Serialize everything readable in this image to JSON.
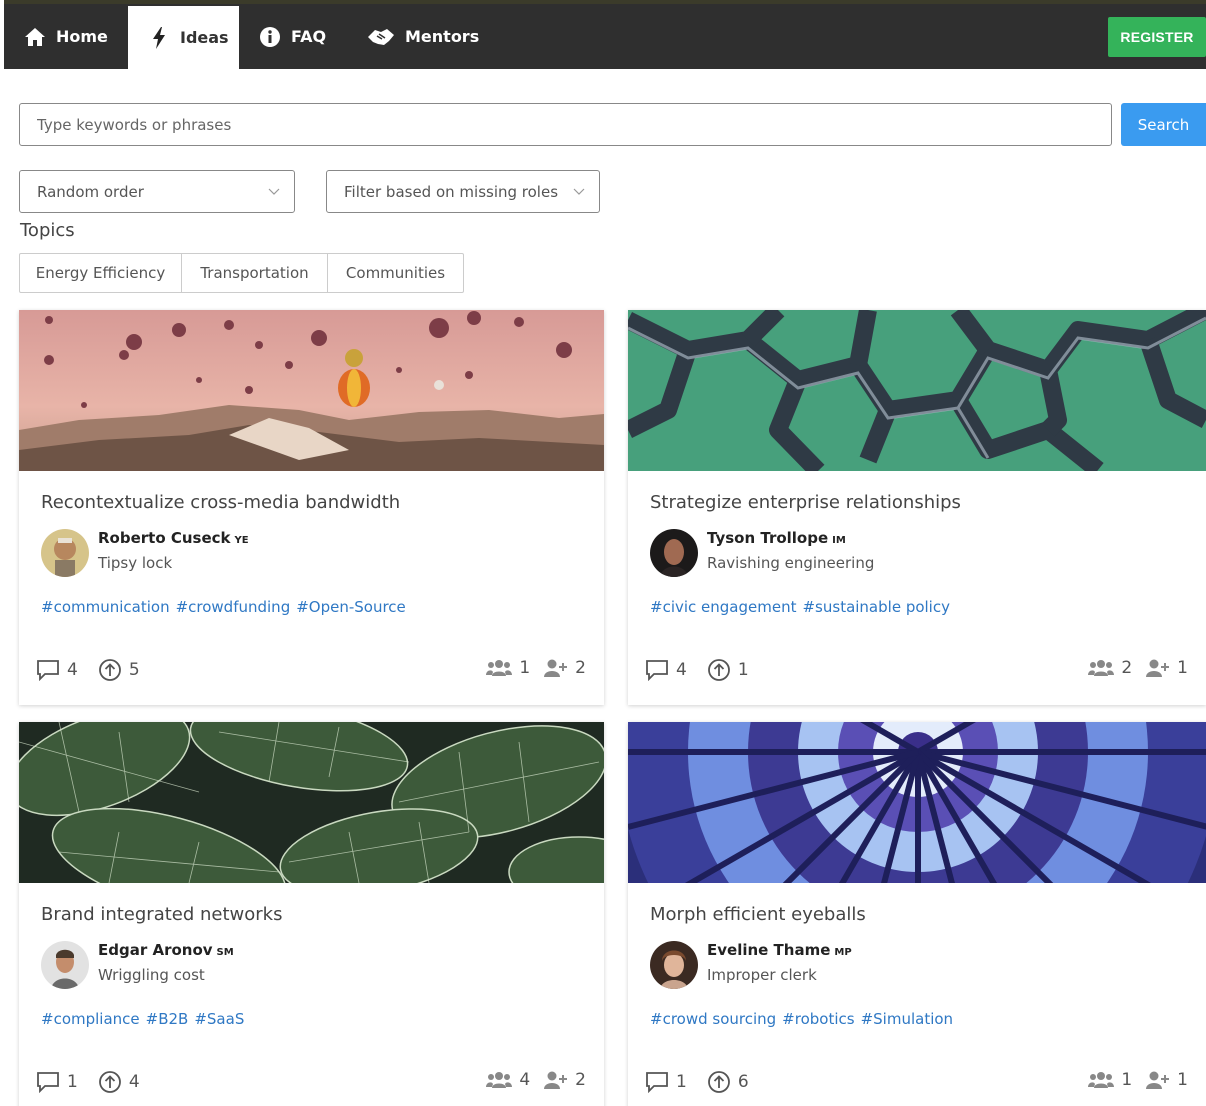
{
  "nav": {
    "items": [
      {
        "label": "Home",
        "icon": "home-icon"
      },
      {
        "label": "Ideas",
        "icon": "bolt-icon"
      },
      {
        "label": "FAQ",
        "icon": "info-icon"
      },
      {
        "label": "Mentors",
        "icon": "handshake-icon"
      }
    ],
    "active": "Ideas",
    "register_label": "REGISTER"
  },
  "search": {
    "placeholder": "Type keywords or phrases",
    "button_label": "Search"
  },
  "filters": {
    "order_value": "Random order",
    "roles_value": "Filter based on missing roles"
  },
  "topics": {
    "label": "Topics",
    "items": [
      "Energy Efficiency",
      "Transportation",
      "Communities"
    ]
  },
  "cards": [
    {
      "title": "Recontextualize cross-media bandwidth",
      "author": "Roberto Cuseck",
      "initials": "YE",
      "role": "Tipsy lock",
      "tags": [
        "#communication",
        "#crowdfunding",
        "#Open-Source"
      ],
      "comments": "4",
      "upvotes": "5",
      "team": "1",
      "needed": "2",
      "image": "hot-air-balloons-landscape"
    },
    {
      "title": "Strategize enterprise relationships",
      "author": "Tyson Trollope",
      "initials": "IM",
      "role": "Ravishing engineering",
      "tags": [
        "#civic engagement",
        "#sustainable policy"
      ],
      "comments": "4",
      "upvotes": "1",
      "team": "2",
      "needed": "1",
      "image": "lattice-structure-green"
    },
    {
      "title": "Brand integrated networks",
      "author": "Edgar Aronov",
      "initials": "SM",
      "role": "Wriggling cost",
      "tags": [
        "#compliance",
        "#B2B",
        "#SaaS"
      ],
      "comments": "1",
      "upvotes": "4",
      "team": "4",
      "needed": "2",
      "image": "green-leaves"
    },
    {
      "title": "Morph efficient eyeballs",
      "author": "Eveline Thame",
      "initials": "MP",
      "role": "Improper clerk",
      "tags": [
        "#crowd sourcing",
        "#robotics",
        "#Simulation"
      ],
      "comments": "1",
      "upvotes": "6",
      "team": "1",
      "needed": "1",
      "image": "balloon-fabric-pattern"
    }
  ],
  "colors": {
    "navbar": "#2f2f2f",
    "register": "#34b35a",
    "search_button": "#3a9bf0",
    "tag_link": "#2f78c4"
  }
}
